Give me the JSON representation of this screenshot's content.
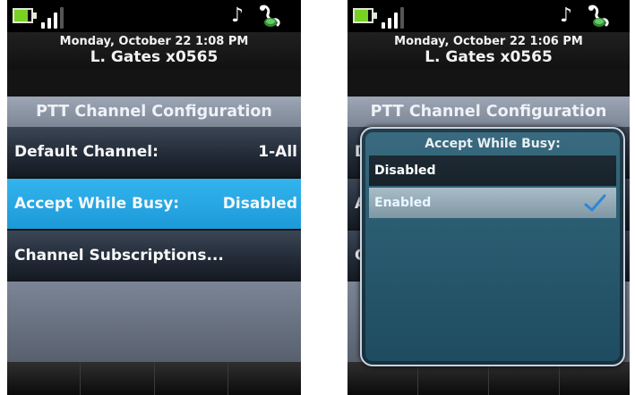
{
  "colors": {
    "selection_blue": "#23a5e4",
    "title_bar": "#8d96a5",
    "dialog_bg": "#2b5d72",
    "battery_green": "#78d223"
  },
  "icons": [
    "battery-icon",
    "signal-strength-icon",
    "music-note-icon",
    "headset-icon",
    "checkmark-icon"
  ],
  "left": {
    "header": {
      "datetime": "Monday, October 22 1:08 PM",
      "user": "L. Gates x0565"
    },
    "screen_title": "PTT Channel Configuration",
    "rows": [
      {
        "label": "Default Channel:",
        "value": "1-All",
        "selected": false
      },
      {
        "label": "Accept While Busy:",
        "value": "Disabled",
        "selected": true
      },
      {
        "label": "Channel Subscriptions...",
        "value": "",
        "selected": false
      }
    ]
  },
  "right": {
    "header": {
      "datetime": "Monday, October 22 1:06 PM",
      "user": "L. Gates x0565"
    },
    "screen_title": "PTT Channel Configuration",
    "rows": [
      {
        "label": "D",
        "value": "ll"
      },
      {
        "label": "A",
        "value": ""
      },
      {
        "label": "C",
        "value": ""
      }
    ],
    "dialog": {
      "title": "Accept While Busy:",
      "options": [
        {
          "label": "Disabled",
          "selected": false
        },
        {
          "label": "Enabled",
          "selected": true
        }
      ]
    }
  }
}
